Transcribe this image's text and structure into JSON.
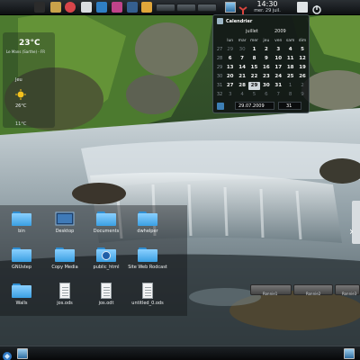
{
  "top_panel": {
    "launchers": [
      {
        "name": "folder-launcher-icon",
        "color": "#2b2b2b"
      },
      {
        "name": "hammer-icon",
        "color": "#c9a24a"
      },
      {
        "name": "record-icon",
        "color": "#d8454a"
      },
      {
        "name": "notes-icon",
        "color": "#d9dde0"
      },
      {
        "name": "globe-icon",
        "color": "#2f7fc4"
      },
      {
        "name": "book-icon",
        "color": "#c0438a"
      },
      {
        "name": "chart-icon",
        "color": "#355f8f"
      },
      {
        "name": "palette-icon",
        "color": "#e0a63a"
      }
    ],
    "clock": {
      "time": "14:30",
      "date": "mer. 29 juil."
    }
  },
  "weather": {
    "current_temp": "23°C",
    "location": "Le Mans (Sarthe) - FR",
    "day": "Jeu",
    "high": "26°C",
    "low": "11°C",
    "sun_color": "#f4c21e"
  },
  "calendar": {
    "title": "Calendrier",
    "month": "juillet",
    "year": "2009",
    "weekdays": [
      "lun",
      "mar",
      "mer",
      "jeu",
      "ven",
      "sam",
      "dim"
    ],
    "weeks": [
      {
        "wk": "27",
        "days": [
          "29",
          "30",
          "1",
          "2",
          "3",
          "4",
          "5"
        ],
        "other": [
          0,
          1
        ]
      },
      {
        "wk": "28",
        "days": [
          "6",
          "7",
          "8",
          "9",
          "10",
          "11",
          "12"
        ],
        "other": []
      },
      {
        "wk": "29",
        "days": [
          "13",
          "14",
          "15",
          "16",
          "17",
          "18",
          "19"
        ],
        "other": []
      },
      {
        "wk": "30",
        "days": [
          "20",
          "21",
          "22",
          "23",
          "24",
          "25",
          "26"
        ],
        "other": []
      },
      {
        "wk": "31",
        "days": [
          "27",
          "28",
          "29",
          "30",
          "31",
          "1",
          "2"
        ],
        "other": [
          5,
          6
        ]
      },
      {
        "wk": "32",
        "days": [
          "3",
          "4",
          "5",
          "6",
          "7",
          "8",
          "9"
        ],
        "other": [
          0,
          1,
          2,
          3,
          4,
          5,
          6
        ]
      }
    ],
    "today": "29",
    "date_field": "29.07.2009",
    "week_field": "31"
  },
  "folderview": {
    "items": [
      {
        "label": "bin",
        "kind": "folder"
      },
      {
        "label": "Desktop",
        "kind": "desktop"
      },
      {
        "label": "Documents",
        "kind": "folder"
      },
      {
        "label": "dwhelper",
        "kind": "folder"
      },
      {
        "label": "GNUstep",
        "kind": "folder"
      },
      {
        "label": "Copy Media",
        "kind": "folder"
      },
      {
        "label": "public_html",
        "kind": "folder-web"
      },
      {
        "label": "Site Web Rodcast",
        "kind": "folder"
      },
      {
        "label": "Walls",
        "kind": "folder"
      },
      {
        "label": "jos.ods",
        "kind": "document"
      },
      {
        "label": "jos.odt",
        "kind": "document"
      },
      {
        "label": "untitled_0.ods",
        "kind": "document"
      }
    ]
  },
  "right_panel": {
    "pills": [
      "Ronnie1",
      "Ronnie2",
      "Ronnie3"
    ]
  }
}
